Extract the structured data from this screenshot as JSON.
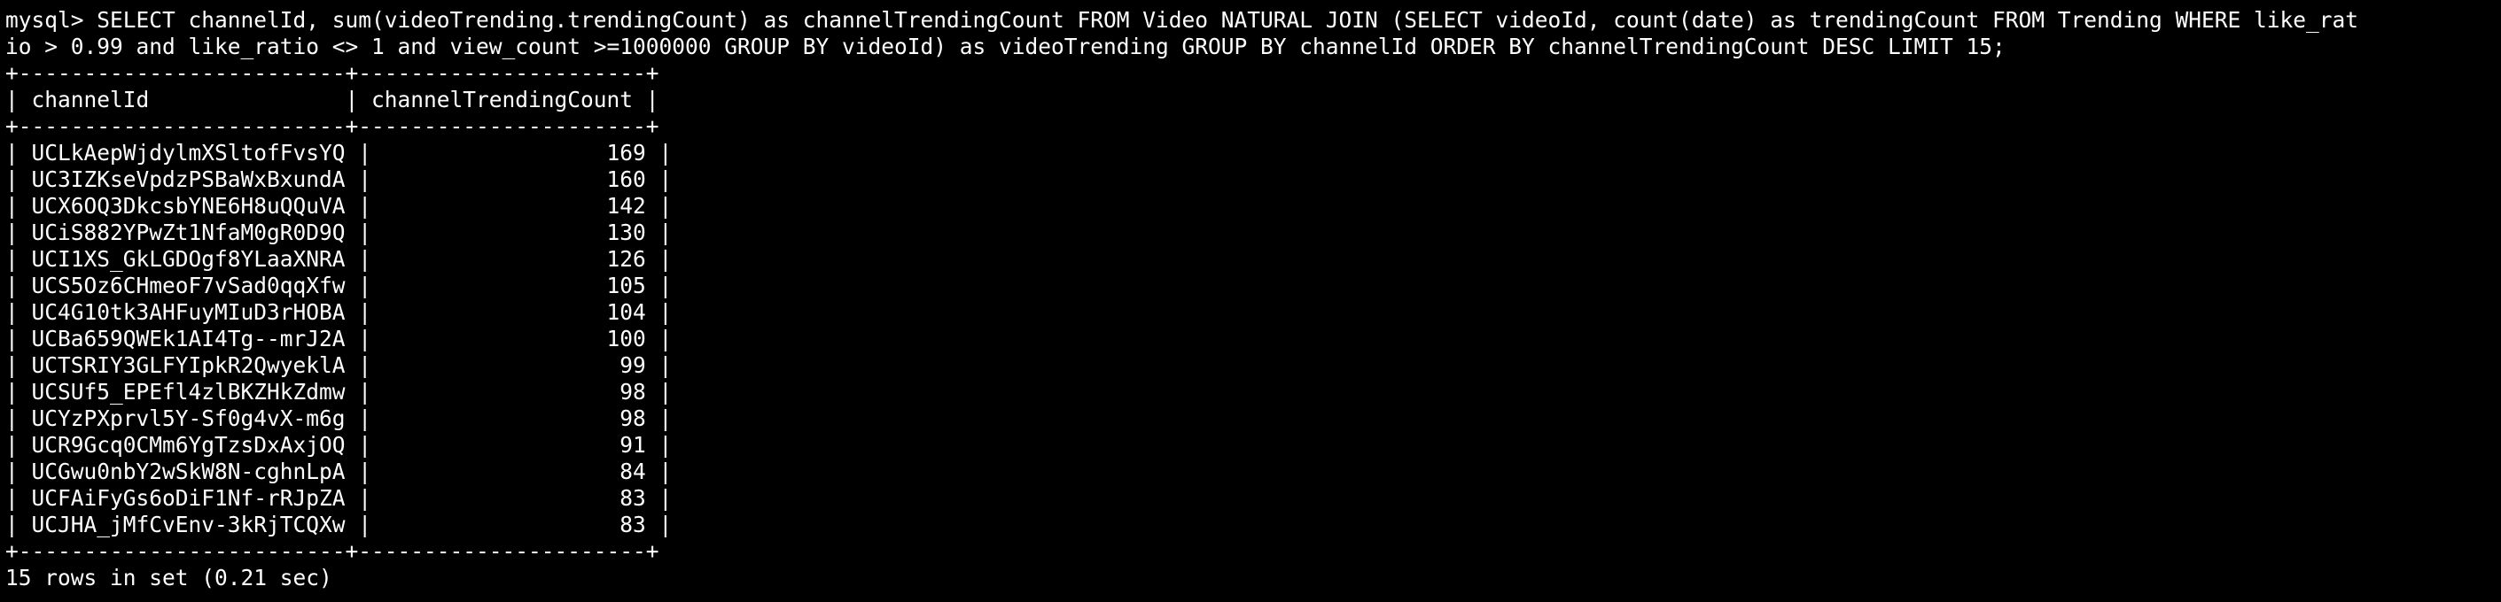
{
  "terminal": {
    "prompt": "mysql> ",
    "command_line_1": "SELECT channelId, sum(videoTrending.trendingCount) as channelTrendingCount FROM Video NATURAL JOIN (SELECT videoId, count(date) as trendingCount FROM Trending WHERE like_rat",
    "command_line_2": "io > 0.99 and like_ratio <> 1 and view_count >=1000000 GROUP BY videoId) as videoTrending GROUP BY channelId ORDER BY channelTrendingCount DESC LIMIT 15;",
    "table": {
      "border": "+-------------------------+----------------------+",
      "header": "| channelId               | channelTrendingCount |",
      "rows": [
        "| UCLkAepWjdylmXSltofFvsYQ |                  169 |",
        "| UC3IZKseVpdzPSBaWxBxundA |                  160 |",
        "| UCX6OQ3DkcsbYNE6H8uQQuVA |                  142 |",
        "| UCiS882YPwZt1NfaM0gR0D9Q |                  130 |",
        "| UCI1XS_GkLGDOgf8YLaaXNRA |                  126 |",
        "| UCS5Oz6CHmeoF7vSad0qqXfw |                  105 |",
        "| UC4G10tk3AHFuyMIuD3rHOBA |                  104 |",
        "| UCBa659QWEk1AI4Tg--mrJ2A |                  100 |",
        "| UCTSRIY3GLFYIpkR2QwyeklA |                   99 |",
        "| UCSUf5_EPEfl4zlBKZHkZdmw |                   98 |",
        "| UCYzPXprvl5Y-Sf0g4vX-m6g |                   98 |",
        "| UCR9Gcq0CMm6YgTzsDxAxjOQ |                   91 |",
        "| UCGwu0nbY2wSkW8N-cghnLpA |                   84 |",
        "| UCFAiFyGs6oDiF1Nf-rRJpZA |                   83 |",
        "| UCJHA_jMfCvEnv-3kRjTCQXw |                   83 |"
      ]
    },
    "result_summary": "15 rows in set (0.21 sec)",
    "colors": {
      "background": "#000000",
      "text": "#ffffff"
    }
  }
}
